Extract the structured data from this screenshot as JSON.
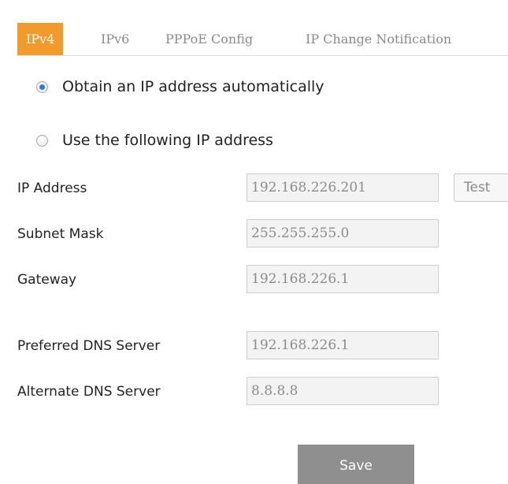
{
  "tabs": [
    {
      "label": "IPv4",
      "active": true
    },
    {
      "label": "IPv6",
      "active": false
    },
    {
      "label": "PPPoE Config",
      "active": false
    },
    {
      "label": "IP Change Notification",
      "active": false
    }
  ],
  "ip_mode": {
    "options": [
      {
        "label": "Obtain an IP address automatically",
        "selected": true
      },
      {
        "label": "Use the following IP address",
        "selected": false
      }
    ]
  },
  "fields": {
    "ip_address": {
      "label": "IP Address",
      "value": "192.168.226.201"
    },
    "subnet_mask": {
      "label": "Subnet Mask",
      "value": "255.255.255.0"
    },
    "gateway": {
      "label": "Gateway",
      "value": "192.168.226.1"
    },
    "preferred_dns": {
      "label": "Preferred DNS Server",
      "value": "192.168.226.1"
    },
    "alternate_dns": {
      "label": "Alternate DNS Server",
      "value": "8.8.8.8"
    }
  },
  "buttons": {
    "test": "Test",
    "save": "Save"
  },
  "colors": {
    "active_tab": "#f39a2c",
    "save_button": "#8f8f8f",
    "radio_selected": "#2f7ad6"
  }
}
